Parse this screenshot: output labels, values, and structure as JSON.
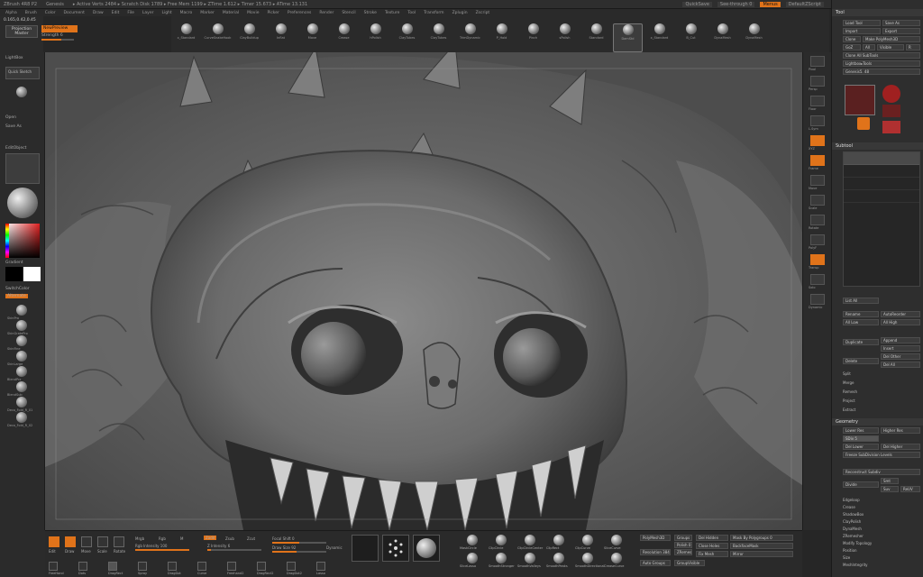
{
  "title_bar": {
    "app": "ZBrush 4R8 P2",
    "doc": "Genesis",
    "stats": "▸ Active Verts 2484  ▸ Scratch Disk 1789  ▸ Free Mem 1199  ▸ ZTime 1.612  ▸ Timer 15.673  ▸ ATime 13.131",
    "quicksave": "QuickSave",
    "see_through": "See-through  0",
    "menus": "Menus",
    "default_script": "DefaultZScript"
  },
  "menu_items": [
    "Alpha",
    "Brush",
    "Color",
    "Document",
    "Draw",
    "Edit",
    "File",
    "Layer",
    "Light",
    "Macro",
    "Marker",
    "Material",
    "Movie",
    "Picker",
    "Preferences",
    "Render",
    "Stencil",
    "Stroke",
    "Texture",
    "Tool",
    "Transform",
    "Zplugin",
    "Zscript"
  ],
  "top_left": {
    "coords": "0.165,0.42,0.45",
    "projection_master": "Projection Master",
    "shelf_label": "NewPreview",
    "strength_label": "Strength 6",
    "strength_value": 0.6
  },
  "brushes": [
    {
      "label": "x_Standard",
      "selected": false
    },
    {
      "label": "CurveSnakeHook",
      "selected": false
    },
    {
      "label": "ClayBuildup",
      "selected": false
    },
    {
      "label": "Inflat",
      "selected": false
    },
    {
      "label": "Move",
      "selected": false
    },
    {
      "label": "Crease",
      "selected": false
    },
    {
      "label": "hPolish",
      "selected": false
    },
    {
      "label": "ClayTubes",
      "selected": false
    },
    {
      "label": "ClayTubes",
      "selected": false
    },
    {
      "label": "TrimDynamic",
      "selected": false
    },
    {
      "label": "P_Hold",
      "selected": false
    },
    {
      "label": "Pinch",
      "selected": false
    },
    {
      "label": "sPolish",
      "selected": false
    },
    {
      "label": "Standard",
      "selected": false
    },
    {
      "label": "DamStd",
      "selected": true
    },
    {
      "label": "x_Standard",
      "selected": false
    },
    {
      "label": "B_Cut",
      "selected": false
    },
    {
      "label": "DynaMesh",
      "selected": false
    },
    {
      "label": "DynaMesh",
      "selected": false
    }
  ],
  "left_tray": {
    "lightbox": "LightBox",
    "quick_sketch": "Quick Sketch",
    "open": "Open",
    "save_as": "Save As",
    "edit_object": "EditObject",
    "gradient": "Gradient",
    "switch_color": "SwitchColor",
    "alternate": "Alternate",
    "brush_labels": [
      "SkinPro",
      "SkinGratePro",
      "SkinFine",
      "SkinLarge",
      "BlendPrx",
      "BlendSub",
      "Deco_Fold_R_01",
      "Deco_Fold_R_02"
    ]
  },
  "right_shelf": {
    "labels": [
      "Pixol",
      "Persp",
      "Floor",
      "L.Sym",
      "XYZ",
      "Frame",
      "Move",
      "Scale",
      "Rotate",
      "PolyF",
      "Transp",
      "Solo",
      "Dynamic"
    ],
    "active": [
      false,
      false,
      false,
      false,
      true,
      true,
      false,
      false,
      false,
      false,
      true,
      false,
      false
    ]
  },
  "right_panel": {
    "header": "Tool",
    "load_tool": "Load Tool",
    "save_as": "Save As",
    "import": "Import",
    "export": "Export",
    "clone": "Clone",
    "make_polymesh": "Make PolyMesh3D",
    "goz": "GoZ",
    "all": "All",
    "visible": "Visible",
    "r": "R",
    "clone_all": "Clone All SubTools",
    "lightbox_tools": "Lightbox▸Tools",
    "genesis_label": "Genesis5. 48",
    "subtool_header": "Subtool",
    "list_all": "List All",
    "rename": "Rename",
    "autoreorder": "AutoReorder",
    "all_low": "All Low",
    "all_high": "All High",
    "duplicate": "Duplicate",
    "append": "Append",
    "insert": "Insert",
    "delete": "Delete",
    "del_other": "Del Other",
    "del_all": "Del All",
    "split": "Split",
    "merge": "Merge",
    "remesh": "Remesh",
    "project": "Project",
    "extract": "Extract",
    "geometry_header": "Geometry",
    "lower_res": "Lower Res",
    "higher_res": "Higher Res",
    "sdiv": "SDiv 5",
    "del_lower": "Del Lower",
    "del_higher": "Del Higher",
    "freeze_subdiv": "Freeze SubDivision Levels",
    "reconstruct": "Reconstruct Subdiv",
    "divide": "Divide",
    "smt": "Smt",
    "suv": "Suv",
    "rsmt": "ReUV",
    "sections": [
      "Edgeloop",
      "Crease",
      "ShadowBox",
      "ClayPolish",
      "DynaMesh",
      "ZRemesher",
      "Modify Topology",
      "Position",
      "Size",
      "MeshIntegrity"
    ]
  },
  "bottom": {
    "tools": [
      "Edit",
      "Draw",
      "Move",
      "Scale",
      "Rotate"
    ],
    "mrgb": "Mrgb",
    "rgb": "Rgb",
    "m": "M",
    "zadd": "Zadd",
    "zsub": "Zsub",
    "zcut": "Zcut",
    "rgb_intensity": "Rgb Intensity 100",
    "z_intensity": "Z Intensity 6",
    "focal_shift": "Focal Shift 0",
    "draw_size": "Draw Size 92",
    "dynamic": "Dynamic",
    "brush_icons": [
      "MaskCircle",
      "ClipCircle",
      "ClipCircleCenter",
      "ClipRect",
      "ClipCurve",
      "SliceCurve",
      "SliceLasso",
      "SmoothStronger",
      "SmoothValleys",
      "SmoothPeaks",
      "SmoothDirectional",
      "CreaseCurve"
    ],
    "polymesh": "PolyMesh3D",
    "groups": "Groups",
    "polish": "Polish 0",
    "zremesher": "ZRemesher",
    "del_hidden": "Del Hidden",
    "mask_by_polygroups": "Mask By Polygroups 0",
    "close_holes": "Close Holes",
    "backface_mask": "BackfaceMask",
    "fix_mesh": "Fix Mesh",
    "mirror": "Mirror",
    "resolution": "Resolution 384",
    "projector": "Project",
    "auto_groups": "Auto Groups",
    "group_visible": "GroupVisible",
    "stroke_labels": [
      "FreeHand",
      "Dots",
      "DragRect",
      "Spray",
      "DragDot",
      "Curve",
      "Freehand2",
      "DragRect2",
      "DragDot2",
      "Lasso"
    ]
  }
}
